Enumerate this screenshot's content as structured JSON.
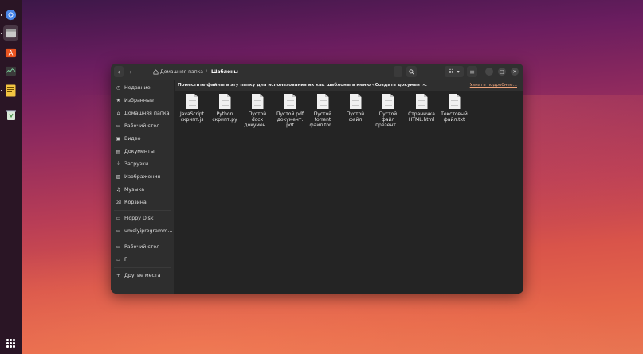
{
  "dock": {
    "items": [
      {
        "icon": "chromium-icon"
      },
      {
        "icon": "files-icon"
      },
      {
        "icon": "software-store-icon"
      },
      {
        "icon": "system-monitor-icon"
      },
      {
        "icon": "text-editor-icon"
      },
      {
        "icon": "trash-icon"
      }
    ],
    "apps_icon": "show-apps-icon"
  },
  "header": {
    "home_label": "Домашняя папка",
    "separator": "/",
    "current_folder": "Шаблоны"
  },
  "sidebar": {
    "items": [
      {
        "label": "Недавние",
        "icon": "clock-icon"
      },
      {
        "label": "Избранные",
        "icon": "star-icon"
      },
      {
        "label": "Домашняя папка",
        "icon": "home-icon"
      },
      {
        "label": "Рабочий стол",
        "icon": "desktop-icon"
      },
      {
        "label": "Видео",
        "icon": "video-icon"
      },
      {
        "label": "Документы",
        "icon": "documents-icon"
      },
      {
        "label": "Загрузки",
        "icon": "download-icon"
      },
      {
        "label": "Изображения",
        "icon": "image-icon"
      },
      {
        "label": "Музыка",
        "icon": "music-icon"
      },
      {
        "label": "Корзина",
        "icon": "trash-icon"
      },
      {
        "label": "Floppy Disk",
        "icon": "drive-icon"
      },
      {
        "label": "umelyiprogramm…",
        "icon": "drive-icon"
      },
      {
        "label": "Рабочий стол",
        "icon": "drive-icon"
      },
      {
        "label": "F",
        "icon": "folder-icon"
      },
      {
        "label": "Другие места",
        "icon": "plus-icon"
      }
    ]
  },
  "banner": {
    "message": "Поместите файлы в эту папку для использования их как шаблоны в меню «Создать документ».",
    "link": "Узнать подробнее…"
  },
  "files": [
    {
      "lines": [
        "JavaScript",
        "скрипт.js"
      ]
    },
    {
      "lines": [
        "Python",
        "скрипт.py"
      ]
    },
    {
      "lines": [
        "Пустой",
        "docx",
        "докумен…"
      ]
    },
    {
      "lines": [
        "Пустой pdf",
        "документ.",
        "pdf"
      ]
    },
    {
      "lines": [
        "Пустой",
        "torrent",
        "файл.tor…"
      ]
    },
    {
      "lines": [
        "Пустой",
        "файл"
      ]
    },
    {
      "lines": [
        "Пустой",
        "файл",
        "презент…"
      ]
    },
    {
      "lines": [
        "Страничка",
        "HTML.html"
      ]
    },
    {
      "lines": [
        "Текстовый",
        "файл.txt"
      ]
    }
  ]
}
